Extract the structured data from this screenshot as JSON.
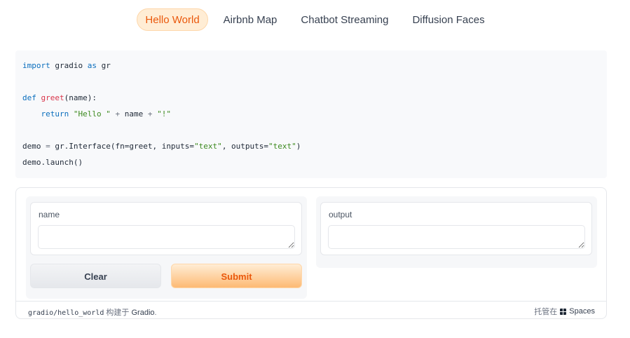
{
  "tabs": [
    {
      "label": "Hello World",
      "active": true
    },
    {
      "label": "Airbnb Map",
      "active": false
    },
    {
      "label": "Chatbot Streaming",
      "active": false
    },
    {
      "label": "Diffusion Faces",
      "active": false
    }
  ],
  "code": {
    "import_kw": "import",
    "import_mod": " gradio ",
    "as_kw": "as",
    "import_alias": " gr",
    "def_kw": "def",
    "func_name": "greet",
    "func_params": "(name):",
    "return_kw": "return",
    "hello_str": "\"Hello \"",
    "plus": "+",
    "name_var": " name ",
    "excl_str": "\"!\"",
    "demo_assign": "demo ",
    "eq": "=",
    "interface_call": " gr.Interface(fn=greet, inputs=",
    "text_str": "\"text\"",
    "outputs_arg": ", outputs=",
    "close_paren": ")",
    "launch_line": "demo.launch()"
  },
  "demo": {
    "input_label": "name",
    "input_value": "",
    "output_label": "output",
    "output_value": "",
    "clear_label": "Clear",
    "submit_label": "Submit"
  },
  "footer": {
    "repo": "gradio/hello_world",
    "built_with": " 构建于 ",
    "gradio_link": "Gradio",
    "period": ".",
    "hosted_on": "托管在",
    "spaces_link": "Spaces"
  },
  "colors": {
    "accent": "#ea580c",
    "accent_bg": "#ffedd5"
  }
}
